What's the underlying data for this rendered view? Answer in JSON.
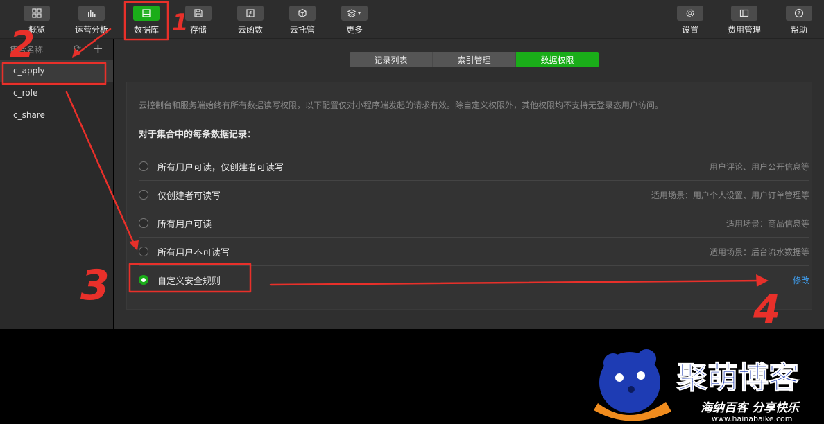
{
  "toolbar": {
    "left_items": [
      {
        "label": "概览",
        "icon": "grid-icon"
      },
      {
        "label": "运营分析",
        "icon": "bar-chart-icon"
      },
      {
        "label": "数据库",
        "icon": "database-icon",
        "active": true
      },
      {
        "label": "存储",
        "icon": "save-icon"
      },
      {
        "label": "云函数",
        "icon": "function-icon"
      },
      {
        "label": "云托管",
        "icon": "cube-icon"
      },
      {
        "label": "更多",
        "icon": "layers-icon"
      }
    ],
    "right_items": [
      {
        "label": "设置",
        "icon": "gear-icon"
      },
      {
        "label": "费用管理",
        "icon": "billing-icon"
      },
      {
        "label": "帮助",
        "icon": "help-icon"
      }
    ]
  },
  "sidebar": {
    "header": "集合名称",
    "collections": [
      {
        "name": "c_apply",
        "active": true
      },
      {
        "name": "c_role"
      },
      {
        "name": "c_share"
      }
    ]
  },
  "tabs": [
    {
      "label": "记录列表"
    },
    {
      "label": "索引管理"
    },
    {
      "label": "数据权限",
      "active": true
    }
  ],
  "permissions": {
    "description": "云控制台和服务端始终有所有数据读写权限，以下配置仅对小程序端发起的请求有效。除自定义权限外，其他权限均不支持无登录态用户访问。",
    "heading": "对于集合中的每条数据记录：",
    "options": [
      {
        "label": "所有用户可读，仅创建者可读写",
        "hint": "用户评论、用户公开信息等"
      },
      {
        "label": "仅创建者可读写",
        "hint": "适用场景：用户个人设置、用户订单管理等"
      },
      {
        "label": "所有用户可读",
        "hint": "适用场景：商品信息等"
      },
      {
        "label": "所有用户不可读写",
        "hint": "适用场景：后台流水数据等"
      },
      {
        "label": "自定义安全规则",
        "selected": true,
        "action": "修改"
      }
    ]
  },
  "annotations": {
    "numbers": [
      "1",
      "2",
      "3",
      "4"
    ],
    "color": "#e8302a"
  },
  "watermark": {
    "title": "聚萌博客",
    "subtitle": "海纳百客 分享快乐",
    "url": "www.hainabaike.com",
    "title_color": "#1e3cb4",
    "accent_color": "#f08c1e"
  },
  "colors": {
    "accent_green": "#1aad19",
    "link_blue": "#3f9ff1"
  }
}
